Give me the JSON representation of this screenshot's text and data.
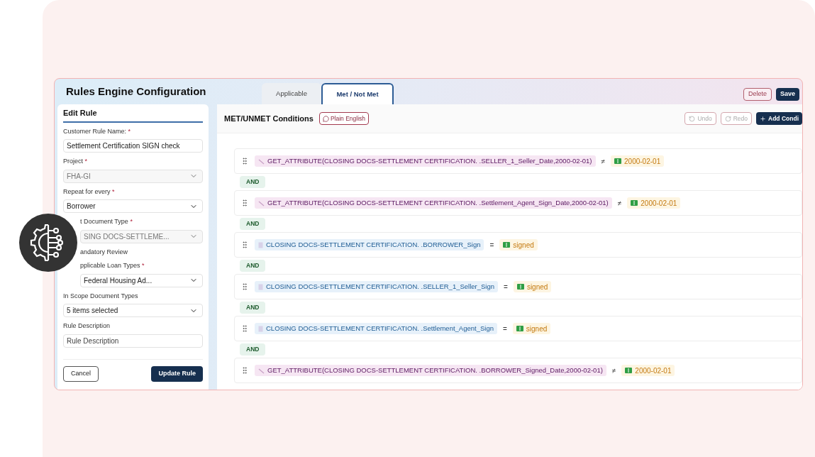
{
  "header": {
    "title": "Rules Engine Configuration",
    "tabs": [
      {
        "label": "Applicable",
        "selected": false
      },
      {
        "label": "Met / Not Met",
        "selected": true
      }
    ],
    "actions": [
      {
        "label": "Delete",
        "kind": "outline"
      },
      {
        "label": "Save",
        "kind": "primary"
      }
    ]
  },
  "edit_rule": {
    "title": "Edit Rule",
    "fields": [
      {
        "label": "Customer Rule Name:",
        "marker": "*",
        "kind": "input",
        "value": "Settlement Certification SIGN check",
        "disabled": false,
        "clipped": false
      },
      {
        "label": "Project",
        "marker": "*",
        "kind": "select",
        "value": "FHA-GI",
        "disabled": true,
        "clipped": false
      },
      {
        "label": "Repeat for every",
        "marker": "*",
        "kind": "select",
        "value": "Borrower",
        "disabled": false,
        "clipped": false
      },
      {
        "label": "t Document Type",
        "marker": "*",
        "kind": "select",
        "value": "SING DOCS-SETTLEME...",
        "disabled": true,
        "clipped": true
      },
      {
        "label": "andatory Review",
        "kind": "label",
        "clipped": true
      },
      {
        "label": "pplicable Loan Types",
        "marker": "*",
        "kind": "select",
        "value": "Federal Housing Ad...",
        "disabled": false,
        "clipped": true
      },
      {
        "label": "In Scope Document Types",
        "kind": "select",
        "value": "5 items selected",
        "disabled": false,
        "clipped": false
      },
      {
        "label": "Rule Description",
        "kind": "input",
        "placeholder": "Rule Description",
        "disabled": false,
        "clipped": false
      }
    ],
    "buttons": [
      {
        "label": "Cancel",
        "kind": "outline"
      },
      {
        "label": "Update Rule",
        "kind": "primary"
      }
    ]
  },
  "conditions": {
    "title": "MET/UNMET Conditions",
    "plain_english": "Plain English",
    "toolbar": [
      {
        "label": "Undo",
        "kind": "undo"
      },
      {
        "label": "Redo",
        "kind": "redo"
      },
      {
        "label": "Add Condi",
        "kind": "add"
      }
    ],
    "rows": [
      {
        "kind": "attribute",
        "expression": "GET_ATTRIBUTE(CLOSING DOCS-SETTLEMENT CERTIFICATION. .SELLER_1_Seller_Date,2000-02-01)",
        "operator": "≠",
        "value": "2000-02-01",
        "joiner": "AND"
      },
      {
        "kind": "attribute",
        "expression": "GET_ATTRIBUTE(CLOSING DOCS-SETTLEMENT CERTIFICATION. .Settlement_Agent_Sign_Date,2000-02-01)",
        "operator": "≠",
        "value": "2000-02-01",
        "joiner": "AND"
      },
      {
        "kind": "field",
        "expression": "CLOSING DOCS-SETTLEMENT CERTIFICATION. .BORROWER_Sign",
        "operator": "=",
        "value": "signed",
        "joiner": "AND"
      },
      {
        "kind": "field",
        "expression": "CLOSING DOCS-SETTLEMENT CERTIFICATION. .SELLER_1_Seller_Sign",
        "operator": "=",
        "value": "signed",
        "joiner": "AND"
      },
      {
        "kind": "field",
        "expression": "CLOSING DOCS-SETTLEMENT CERTIFICATION. .Settlement_Agent_Sign",
        "operator": "=",
        "value": "signed",
        "joiner": "AND"
      },
      {
        "kind": "attribute",
        "expression": "GET_ATTRIBUTE(CLOSING DOCS-SETTLEMENT CERTIFICATION. .BORROWER_Signed_Date,2000-02-01)",
        "operator": "≠",
        "value": "2000-02-01"
      }
    ]
  }
}
